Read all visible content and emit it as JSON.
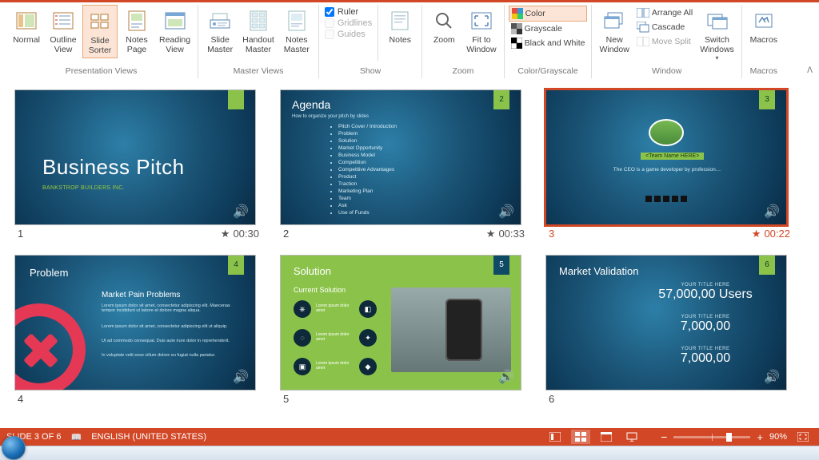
{
  "ribbon": {
    "groups": {
      "presentation_views": {
        "label": "Presentation Views",
        "items": [
          "Normal",
          "Outline\nView",
          "Slide\nSorter",
          "Notes\nPage",
          "Reading\nView"
        ]
      },
      "master_views": {
        "label": "Master Views",
        "items": [
          "Slide\nMaster",
          "Handout\nMaster",
          "Notes\nMaster"
        ]
      },
      "show": {
        "label": "Show",
        "items": [
          "Ruler",
          "Gridlines",
          "Guides"
        ],
        "notes": "Notes"
      },
      "zoom": {
        "label": "Zoom",
        "items": [
          "Zoom",
          "Fit to\nWindow"
        ]
      },
      "color": {
        "label": "Color/Grayscale",
        "items": [
          "Color",
          "Grayscale",
          "Black and White"
        ]
      },
      "window": {
        "label": "Window",
        "items": [
          "New\nWindow",
          "Arrange All",
          "Cascade",
          "Move Split",
          "Switch\nWindows"
        ]
      },
      "macros": {
        "label": "Macros",
        "item": "Macros"
      }
    }
  },
  "slides": [
    {
      "num": "1",
      "dur": "00:30",
      "title": "Business Pitch",
      "subtitle": "BANKSTROP BUILDERS INC."
    },
    {
      "num": "2",
      "dur": "00:33",
      "title": "Agenda",
      "subtitle": "How to organize your pitch by slides",
      "bullets": [
        "Pitch Cover / Introduction",
        "Problem",
        "Solution",
        "Market Opportunity",
        "Business Model",
        "Competition",
        "Competitive Advantages",
        "Product",
        "Traction",
        "Marketing Plan",
        "Team",
        "Ask",
        "Use of Funds"
      ]
    },
    {
      "num": "3",
      "dur": "00:22",
      "name": "<Team Name HERE>",
      "desc": "The CEO is a game developer by profession…"
    },
    {
      "num": "4",
      "title": "Problem",
      "heading": "Market Pain Problems",
      "p1": "Lorem ipsum dolor sit amet, consectetur adipiscing elit. Maecenas tempor incididunt ut labore et dolore magna aliqua.",
      "p2": "Lorem ipsum dolor sit amet, consectetur adipiscing elit ut aliquip.",
      "p3": "Ut ad commodo consequat. Duis aute irure dolor in reprehenderit.",
      "p4": "In voluptate velit esse cillum dolore eu fugiat nulla pariatur."
    },
    {
      "num": "5",
      "title": "Solution",
      "heading": "Current Solution",
      "item": "Lorem ipsum dolor amet"
    },
    {
      "num": "6",
      "title": "Market Validation",
      "blocks": [
        {
          "l": "YOUR TITLE HERE",
          "v": "57,000,00 Users"
        },
        {
          "l": "YOUR TITLE HERE",
          "v": "7,000,00"
        },
        {
          "l": "YOUR TITLE HERE",
          "v": "7,000,00"
        }
      ]
    }
  ],
  "status": {
    "slide": "SLIDE 3 OF 6",
    "lang": "ENGLISH (UNITED STATES)",
    "zoom": "90%"
  }
}
